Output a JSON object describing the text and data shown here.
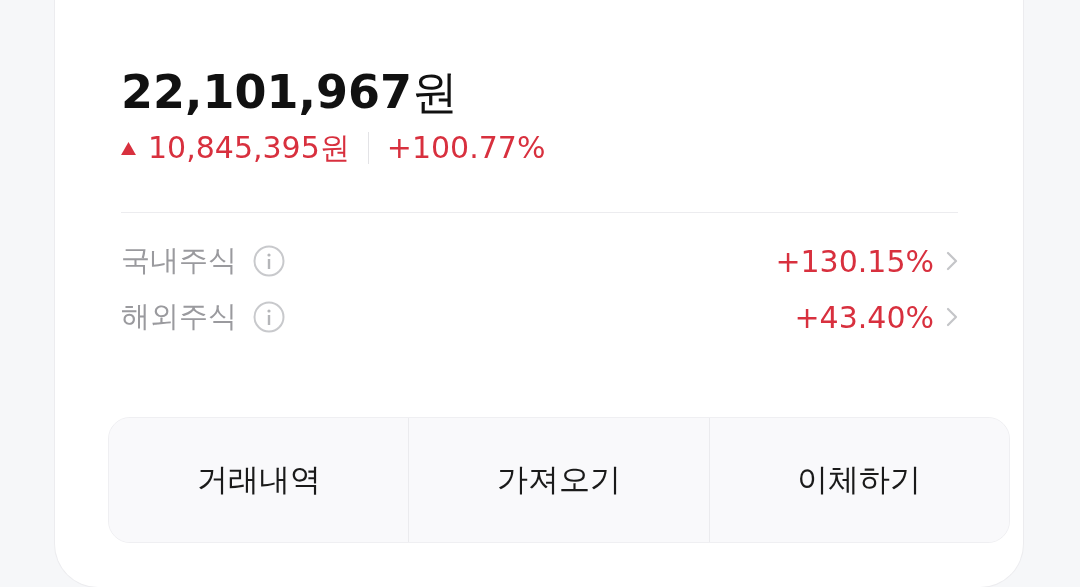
{
  "total": "**22,101,967**원",
  "change": {
    "rising": true,
    "amount": "10,845,395원",
    "rate": "+100.77%"
  },
  "categories": [
    {
      "name": "국내주식",
      "rate": "+130.15%"
    },
    {
      "name": "해외주식",
      "rate": "+43.40%"
    }
  ],
  "actions": [
    "거래내역",
    "가져오기",
    "이체하기"
  ]
}
